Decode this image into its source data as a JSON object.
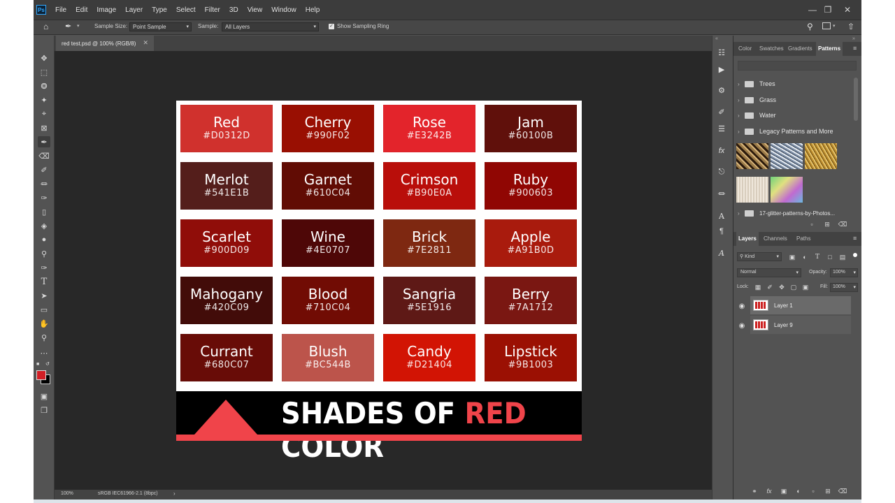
{
  "app": {
    "logo": "Ps",
    "menu": [
      "File",
      "Edit",
      "Image",
      "Layer",
      "Type",
      "Select",
      "Filter",
      "3D",
      "View",
      "Window",
      "Help"
    ]
  },
  "options_bar": {
    "sample_size_label": "Sample Size:",
    "sample_size_value": "Point Sample",
    "sample_label": "Sample:",
    "sample_value": "All Layers",
    "show_ring_label": "Show Sampling Ring",
    "show_ring_checked": true
  },
  "document": {
    "tab_title": "red test.psd @ 100% (RGB/8)",
    "zoom": "100%",
    "color_profile": "sRGB IEC61966-2.1 (8bpc)"
  },
  "swatches": [
    {
      "name": "Red",
      "hex": "#D0312D",
      "color": "#d0312d"
    },
    {
      "name": "Cherry",
      "hex": "#990F02",
      "color": "#990f02"
    },
    {
      "name": "Rose",
      "hex": "#E3242B",
      "color": "#e3242b"
    },
    {
      "name": "Jam",
      "hex": "#60100B",
      "color": "#60100b"
    },
    {
      "name": "Merlot",
      "hex": "#541E1B",
      "color": "#541e1b"
    },
    {
      "name": "Garnet",
      "hex": "#610C04",
      "color": "#610c04"
    },
    {
      "name": "Crimson",
      "hex": "#B90E0A",
      "color": "#b90e0a"
    },
    {
      "name": "Ruby",
      "hex": "#900603",
      "color": "#900603"
    },
    {
      "name": "Scarlet",
      "hex": "#900D09",
      "color": "#900d09"
    },
    {
      "name": "Wine",
      "hex": "#4E0707",
      "color": "#4e0707"
    },
    {
      "name": "Brick",
      "hex": "#7E2811",
      "color": "#7e2811"
    },
    {
      "name": "Apple",
      "hex": "#A91B0D",
      "color": "#a91b0d"
    },
    {
      "name": "Mahogany",
      "hex": "#420C09",
      "color": "#420c09"
    },
    {
      "name": "Blood",
      "hex": "#710C04",
      "color": "#710c04"
    },
    {
      "name": "Sangria",
      "hex": "#5E1916",
      "color": "#5e1916"
    },
    {
      "name": "Berry",
      "hex": "#7A1712",
      "color": "#7a1712"
    },
    {
      "name": "Currant",
      "hex": "#680C07",
      "color": "#680c07"
    },
    {
      "name": "Blush",
      "hex": "#BC544B",
      "color": "#bc544b"
    },
    {
      "name": "Candy",
      "hex": "#D21404",
      "color": "#d21404"
    },
    {
      "name": "Lipstick",
      "hex": "#9B1003",
      "color": "#9b1003"
    }
  ],
  "banner": {
    "title_part1": "SHADES OF ",
    "title_accent": "RED",
    "title_part2": " COLOR",
    "accent_color": "#f0444a"
  },
  "patterns_panel": {
    "tabs": [
      "Color",
      "Swatches",
      "Gradients",
      "Patterns"
    ],
    "active_tab": "Patterns",
    "folders": [
      "Trees",
      "Grass",
      "Water",
      "Legacy Patterns and More",
      "17-glitter-patterns-by-Photos..."
    ]
  },
  "layers_panel": {
    "tabs": [
      "Layers",
      "Channels",
      "Paths"
    ],
    "active_tab": "Layers",
    "filter_kind": "Kind",
    "blend_mode": "Normal",
    "opacity_label": "Opacity:",
    "opacity_value": "100%",
    "lock_label": "Lock:",
    "fill_label": "Fill:",
    "fill_value": "100%",
    "layers": [
      "Layer 1",
      "Layer 9"
    ]
  }
}
